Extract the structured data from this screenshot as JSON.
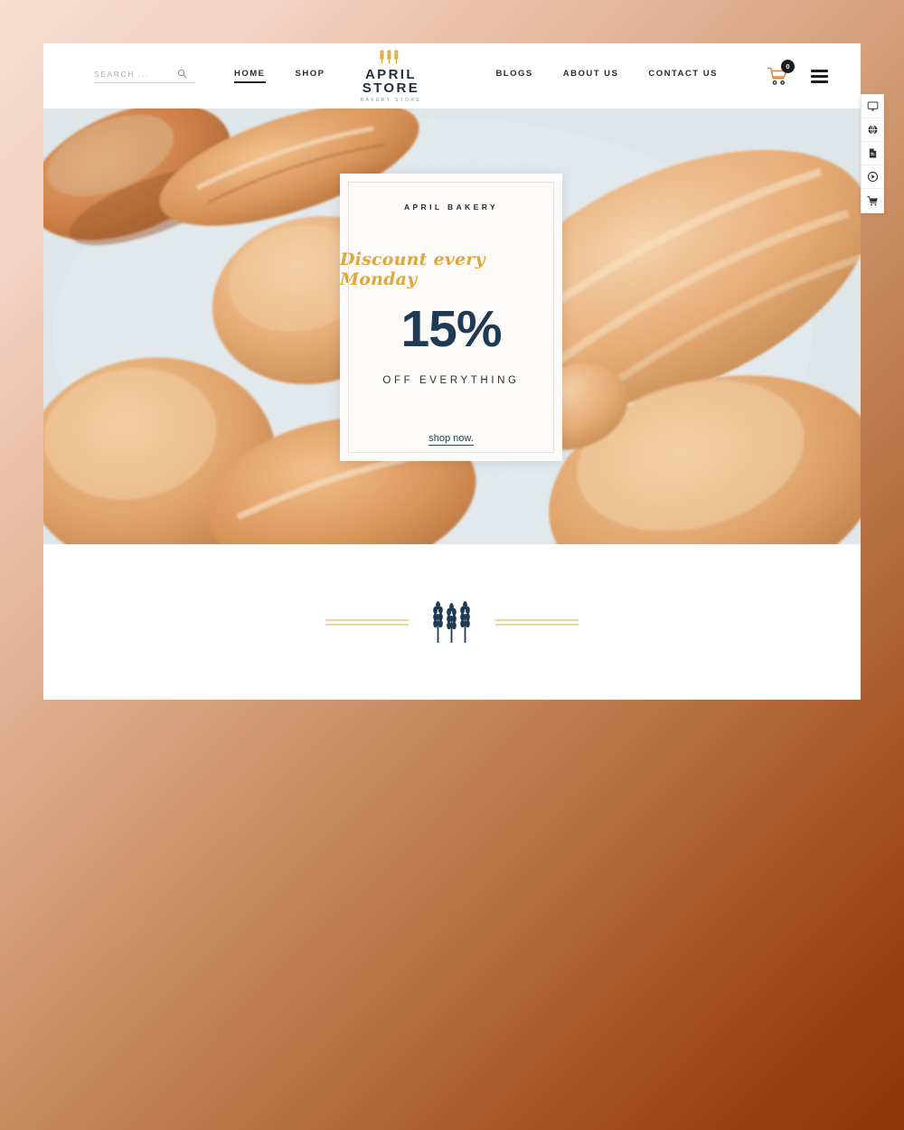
{
  "header": {
    "search": {
      "placeholder": "SEARCH ...",
      "value": "",
      "icon": "search-icon"
    },
    "nav": [
      {
        "label": "HOME",
        "active": true
      },
      {
        "label": "SHOP",
        "active": false
      },
      {
        "label": "BLOGS",
        "active": false
      },
      {
        "label": "ABOUT US",
        "active": false
      },
      {
        "label": "CONTACT US",
        "active": false
      }
    ],
    "logo": {
      "name": "APRIL STORE",
      "subtitle": "BAKERY STORE",
      "icon": "wheat-icon"
    },
    "cart": {
      "icon": "shopping-cart-icon",
      "count": "0"
    },
    "menu": {
      "icon": "hamburger-menu-icon"
    }
  },
  "hero": {
    "promo": {
      "brand": "APRIL BAKERY",
      "script": "Discount every Monday",
      "percent": "15%",
      "subtitle": "OFF EVERYTHING",
      "cta": "shop now."
    }
  },
  "divider": {
    "icon": "wheat-stalks-icon"
  },
  "floating_toolbar": [
    {
      "icon": "monitor-icon"
    },
    {
      "icon": "globe-icon"
    },
    {
      "icon": "document-icon"
    },
    {
      "icon": "play-circle-icon"
    },
    {
      "icon": "cart-icon"
    }
  ],
  "colors": {
    "navy": "#1e3a54",
    "gold": "#e0a63a",
    "gold_line": "#f0d49a",
    "dark": "#1d1d1f",
    "bg_start": "#f7ddcf",
    "bg_end": "#8d3709",
    "card_bg": "#ffffff"
  }
}
